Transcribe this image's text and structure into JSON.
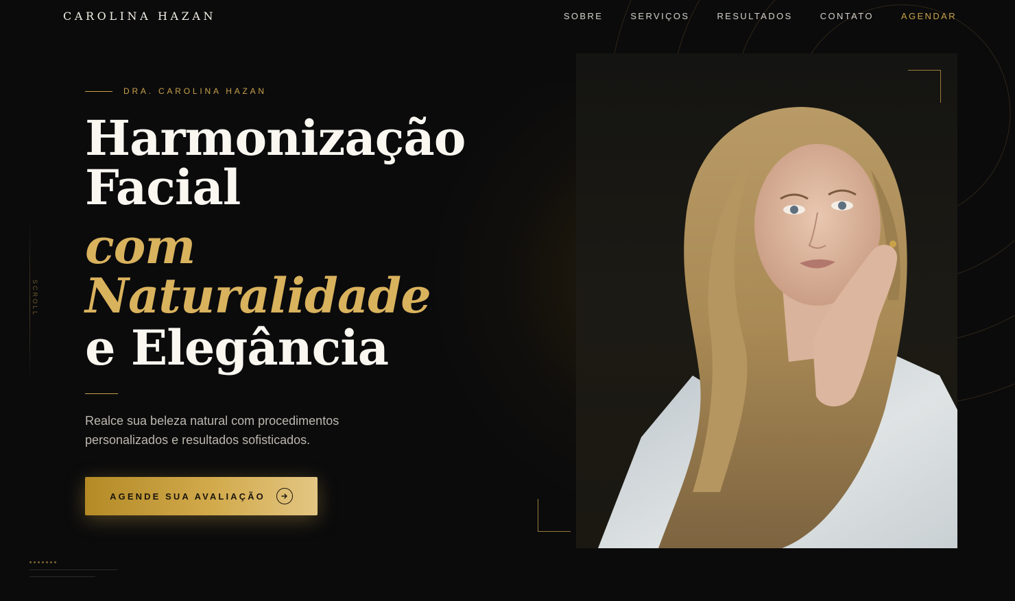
{
  "nav": {
    "logo": "CAROLINA HAZAN",
    "links": [
      "SOBRE",
      "SERVIÇOS",
      "RESULTADOS",
      "CONTATO"
    ],
    "cta": "AGENDAR"
  },
  "hero": {
    "eyebrow": "DRA. CAROLINA HAZAN",
    "headline": {
      "line1": "Harmonização",
      "line2": "Facial",
      "line3_italic": "com",
      "line4_italic": "Naturalidade",
      "line5": "e Elegância"
    },
    "subtext": "Realce sua beleza natural com procedimentos personalizados e resultados sofisticados.",
    "cta_label": "AGENDE SUA AVALIAÇÃO",
    "cta_icon": "arrow-right-icon",
    "scroll_label": "SCROLL"
  },
  "colors": {
    "background": "#0b0b0c",
    "accent_gold": "#c9a24a",
    "headline_white": "#faf7f1",
    "headline_italic_gold": "#d9b25d"
  }
}
